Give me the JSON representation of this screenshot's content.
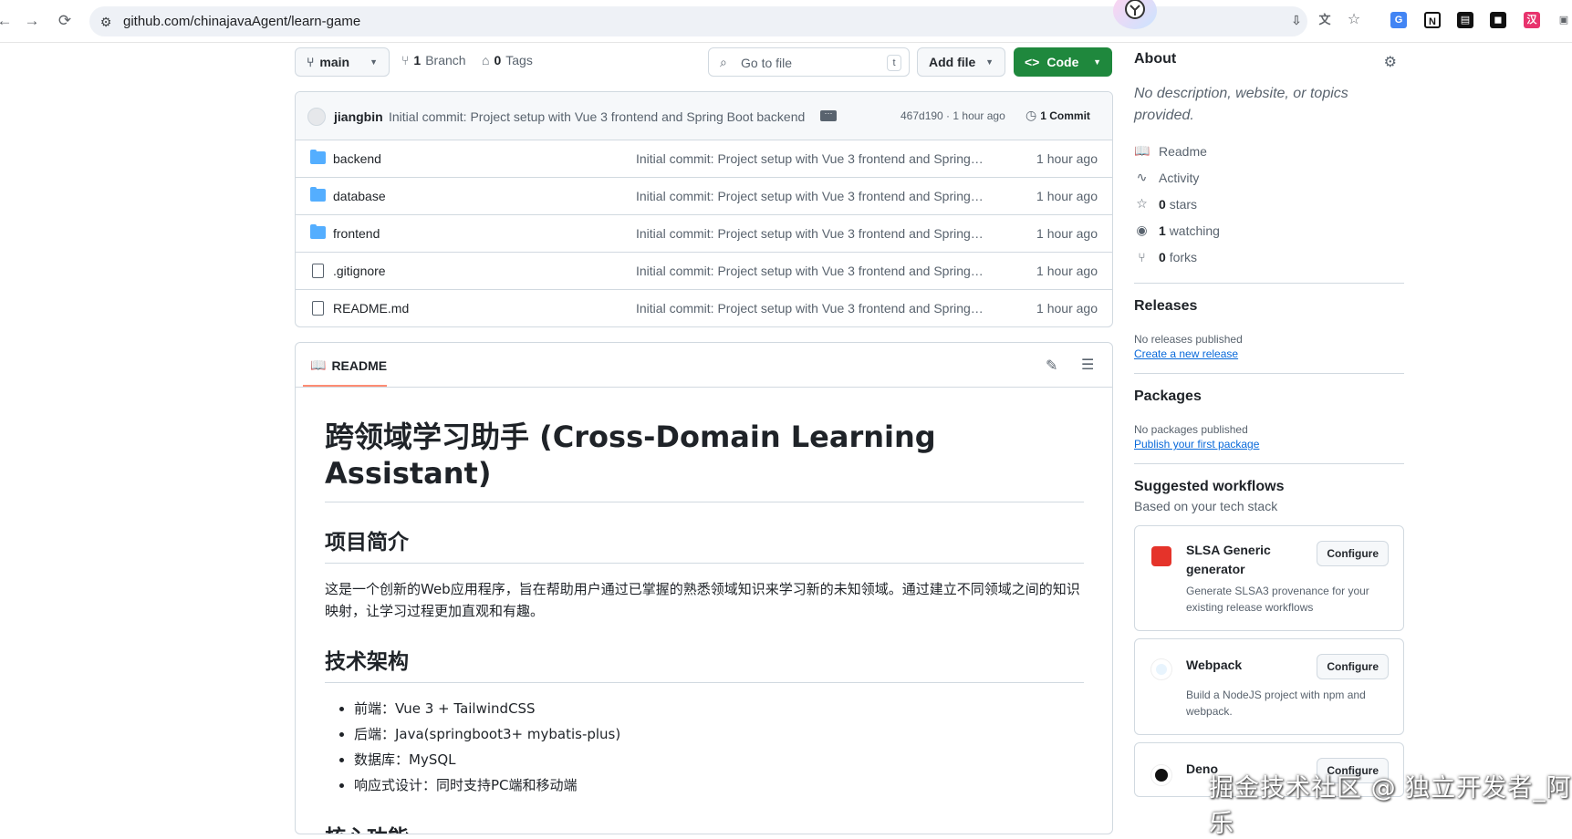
{
  "browser": {
    "url": "github.com/chinajavaAgent/learn-game"
  },
  "toolbar": {
    "branch_label": "main",
    "branches_count": "1",
    "branches_label": "Branch",
    "tags_count": "0",
    "tags_label": "Tags",
    "goto_placeholder": "Go to file",
    "goto_shortcut": "t",
    "add_file_label": "Add file",
    "code_label": "Code"
  },
  "latest_commit": {
    "author": "jiangbin",
    "message": "Initial commit: Project setup with Vue 3 frontend and Spring Boot backend",
    "hash_time": "467d190 · 1 hour ago",
    "commit_count": "1 Commit"
  },
  "files": [
    {
      "name": "backend",
      "type": "folder",
      "commit": "Initial commit: Project setup with Vue 3 frontend and Spring Boot backend",
      "age": "1 hour ago"
    },
    {
      "name": "database",
      "type": "folder",
      "commit": "Initial commit: Project setup with Vue 3 frontend and Spring Boot backend",
      "age": "1 hour ago"
    },
    {
      "name": "frontend",
      "type": "folder",
      "commit": "Initial commit: Project setup with Vue 3 frontend and Spring Boot backend",
      "age": "1 hour ago"
    },
    {
      "name": ".gitignore",
      "type": "file",
      "commit": "Initial commit: Project setup with Vue 3 frontend and Spring Boot backend",
      "age": "1 hour ago"
    },
    {
      "name": "README.md",
      "type": "file",
      "commit": "Initial commit: Project setup with Vue 3 frontend and Spring Boot backend",
      "age": "1 hour ago"
    }
  ],
  "readme": {
    "tab_label": "README",
    "title": "跨领域学习助手 (Cross-Domain Learning Assistant)",
    "h_intro": "项目简介",
    "intro_text": "这是一个创新的Web应用程序，旨在帮助用户通过已掌握的熟悉领域知识来学习新的未知领域。通过建立不同领域之间的知识映射，让学习过程更加直观和有趣。",
    "h_tech": "技术架构",
    "tech_items": [
      "前端：Vue 3 + TailwindCSS",
      "后端：Java(springboot3+ mybatis-plus)",
      "数据库：MySQL",
      "响应式设计：同时支持PC端和移动端"
    ],
    "h_features": "核心功能"
  },
  "sidebar": {
    "about_title": "About",
    "about_desc": "No description, website, or topics provided.",
    "readme_label": "Readme",
    "activity_label": "Activity",
    "stars_count": "0",
    "stars_label": "stars",
    "watching_count": "1",
    "watching_label": "watching",
    "forks_count": "0",
    "forks_label": "forks",
    "releases_title": "Releases",
    "releases_none": "No releases published",
    "releases_link": "Create a new release",
    "packages_title": "Packages",
    "packages_none": "No packages published",
    "packages_link": "Publish your first package",
    "workflows_title": "Suggested workflows",
    "workflows_sub": "Based on your tech stack",
    "workflows": [
      {
        "title": "SLSA Generic generator",
        "desc": "Generate SLSA3 provenance for your existing release workflows",
        "button": "Configure"
      },
      {
        "title": "Webpack",
        "desc": "Build a NodeJS project with npm and webpack.",
        "button": "Configure"
      },
      {
        "title": "Deno",
        "desc": "",
        "button": "Configure"
      }
    ]
  },
  "watermark": "掘金技术社区 @ 独立开发者_阿乐",
  "colors": {
    "accent_green": "#1f883d",
    "link_blue": "#0969da",
    "folder_blue": "#54aeff",
    "tab_underline": "#fd8c73"
  }
}
